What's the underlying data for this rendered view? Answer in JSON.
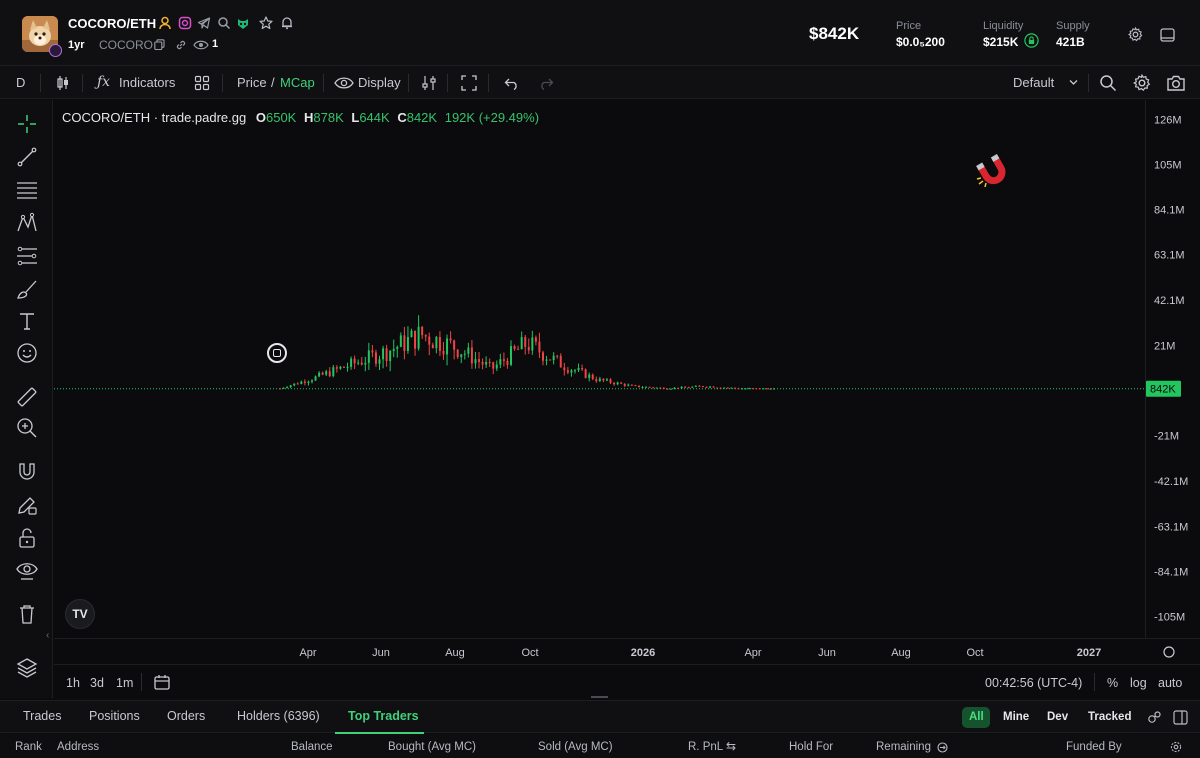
{
  "header": {
    "token_name": "COCORO/ETH",
    "age": "1yr",
    "ticker": "COCORO",
    "watchers": "1",
    "market_cap": "$842K",
    "stats": [
      {
        "label": "Price",
        "value": "$0.0₅200"
      },
      {
        "label": "Liquidity",
        "value": "$215K"
      },
      {
        "label": "Supply",
        "value": "421B"
      }
    ]
  },
  "toolbar": {
    "interval": "D",
    "indicators": "Indicators",
    "price": "Price",
    "slash": "/",
    "mcap": "MCap",
    "display": "Display",
    "layout": "Default"
  },
  "chart": {
    "legend": {
      "symbol": "COCORO/ETH · trade.padre.gg",
      "o_label": "O",
      "o": "650K",
      "h_label": "H",
      "h": "878K",
      "l_label": "L",
      "l": "644K",
      "c_label": "C",
      "c": "842K",
      "change": "192K (+29.49%)"
    },
    "price_ticks": [
      "126M",
      "105M",
      "84.1M",
      "63.1M",
      "42.1M",
      "21M",
      "-21M",
      "-42.1M",
      "-63.1M",
      "-84.1M",
      "-105M"
    ],
    "current_price_label": "842K",
    "time_ticks": [
      "Apr",
      "Jun",
      "Aug",
      "Oct",
      "2026",
      "Apr",
      "Jun",
      "Aug",
      "Oct",
      "2027"
    ],
    "watermark": "TV",
    "magnet_icon": "magnet-icon",
    "colors": {
      "up": "#22c55e",
      "down": "#ef4444",
      "price_line": "#22c55e"
    }
  },
  "chart_data": {
    "type": "candlestick",
    "title": "COCORO/ETH · trade.padre.gg",
    "y_unit": "MCap",
    "ylim": [
      -115,
      135
    ],
    "y_ticks_millions": [
      126,
      105,
      84.1,
      63.1,
      42.1,
      21,
      -21,
      -42.1,
      -63.1,
      -84.1,
      -105
    ],
    "x_ticks": [
      "Apr",
      "Jun",
      "Aug",
      "Oct",
      "2026",
      "Apr",
      "Jun",
      "Aug",
      "Oct",
      "2027"
    ],
    "series_approx_millions": [
      {
        "x": "Mar",
        "y": 1
      },
      {
        "x": "Apr",
        "y": 6
      },
      {
        "x": "Apr",
        "y": 12
      },
      {
        "x": "May",
        "y": 18
      },
      {
        "x": "Jun",
        "y": 26
      },
      {
        "x": "Jun",
        "y": 20
      },
      {
        "x": "Jul",
        "y": 10
      },
      {
        "x": "Jul",
        "y": 22
      },
      {
        "x": "Aug",
        "y": 12
      },
      {
        "x": "Sep",
        "y": 5
      },
      {
        "x": "Oct",
        "y": 2
      },
      {
        "x": "Dec",
        "y": 1
      },
      {
        "x": "2026",
        "y": 2
      },
      {
        "x": "Feb",
        "y": 1
      },
      {
        "x": "Apr",
        "y": 0.8
      }
    ],
    "last": {
      "open": "650K",
      "high": "878K",
      "low": "644K",
      "close": "842K",
      "change": "192K (+29.49%)"
    }
  },
  "range": {
    "buttons": [
      "1h",
      "3d",
      "1m"
    ],
    "clock": "00:42:56 (UTC-4)",
    "percent": "%",
    "log": "log",
    "auto": "auto"
  },
  "tabs": {
    "items": [
      "Trades",
      "Positions",
      "Orders",
      "Holders (6396)",
      "Top Traders"
    ],
    "active": "Top Traders",
    "filters": [
      "All",
      "Mine",
      "Dev",
      "Tracked"
    ]
  },
  "table": {
    "headers": [
      "Rank",
      "Address",
      "Balance",
      "Bought (Avg MC)",
      "Sold (Avg MC)",
      "R. PnL",
      "Hold For",
      "Remaining",
      "Funded By"
    ]
  }
}
